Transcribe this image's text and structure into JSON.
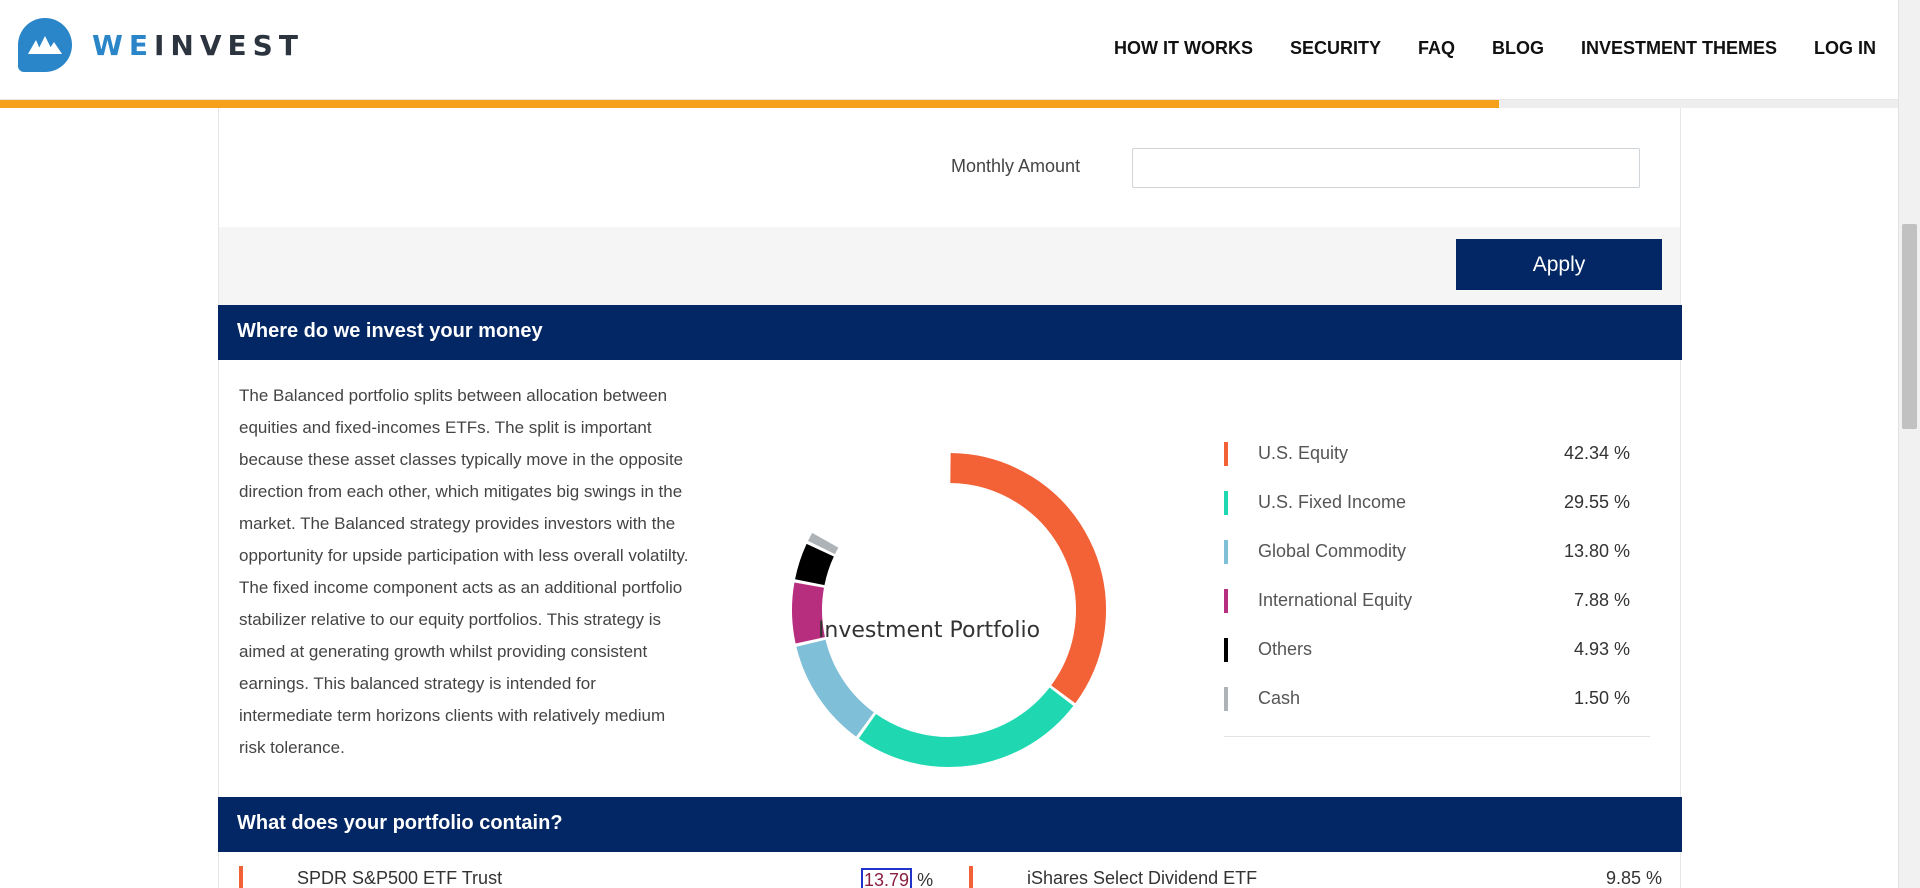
{
  "brand": {
    "name_prefix": "WE",
    "name_suffix": "INVEST",
    "primary_color": "#032764",
    "accent_color": "#2a86c8"
  },
  "nav": {
    "items": [
      "HOW IT WORKS",
      "SECURITY",
      "FAQ",
      "BLOG",
      "INVESTMENT THEMES",
      "LOG IN"
    ]
  },
  "progress": {
    "percent": 79,
    "color": "#f7a01b"
  },
  "form": {
    "monthly_label": "Monthly Amount",
    "monthly_value": "",
    "apply_label": "Apply"
  },
  "section1": {
    "title": "Where do we invest your money",
    "description": "The Balanced portfolio splits between allocation between equities and fixed-incomes ETFs. The split is important because these asset classes typically move in the opposite direction from each other, which mitigates big swings in the market. The Balanced strategy provides investors with the opportunity for upside participation with less overall volatilty. The fixed income component acts as an additional portfolio stabilizer relative to our equity portfolios. This strategy is aimed at generating growth whilst providing consistent earnings. This balanced strategy is intended for intermediate term horizons clients with relatively medium risk tolerance."
  },
  "chart_data": {
    "type": "pie",
    "title": "Investment Portfolio",
    "slices": [
      {
        "label": "U.S. Equity",
        "value": 42.34,
        "display": "42.34 %",
        "color": "#f36136"
      },
      {
        "label": "U.S. Fixed Income",
        "value": 29.55,
        "display": "29.55 %",
        "color": "#1fd8b1"
      },
      {
        "label": "Global Commodity",
        "value": 13.8,
        "display": "13.80 %",
        "color": "#7fbfd8"
      },
      {
        "label": "International Equity",
        "value": 7.88,
        "display": "7.88 %",
        "color": "#b72e7e"
      },
      {
        "label": "Others",
        "value": 4.93,
        "display": "4.93 %",
        "color": "#000000"
      },
      {
        "label": "Cash",
        "value": 1.5,
        "display": "1.50 %",
        "color": "#aeb3b8"
      }
    ]
  },
  "section2": {
    "title": "What does your portfolio contain?",
    "holdings": [
      {
        "name": "SPDR S&P500 ETF Trust",
        "value": "13.79",
        "unit": "%"
      },
      {
        "name": "iShares Select Dividend ETF",
        "value": "9.85 %"
      }
    ]
  },
  "icons": {
    "logo": "mountain-logo-icon"
  }
}
